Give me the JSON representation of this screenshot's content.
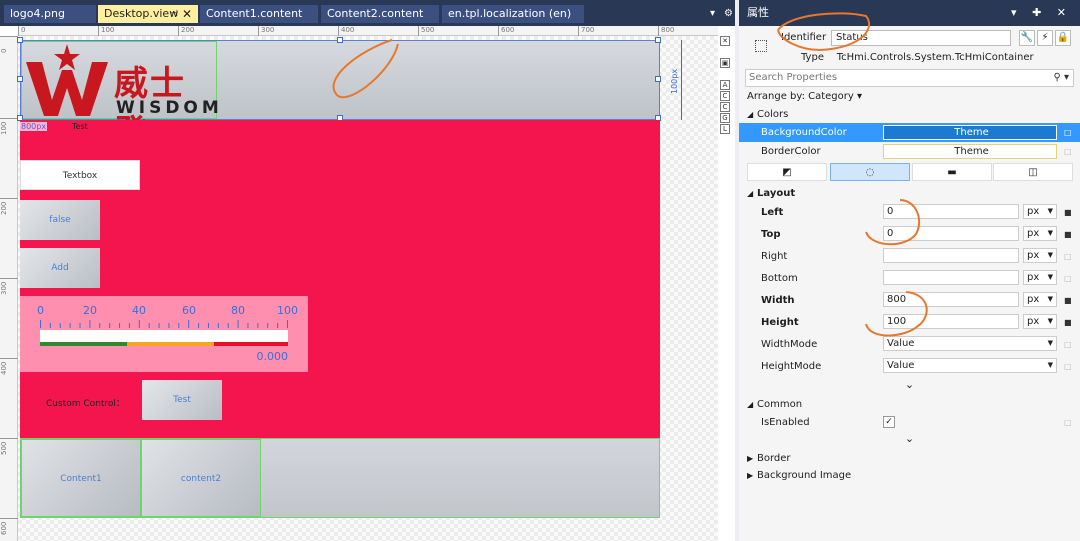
{
  "tabs": [
    {
      "label": "logo4.png"
    },
    {
      "label": "Desktop.view",
      "pin": "⊣",
      "close": "✕"
    },
    {
      "label": "Content1.content"
    },
    {
      "label": "Content2.content"
    },
    {
      "label": "en.tpl.localization (en)"
    }
  ],
  "tabstrip_controls": {
    "dropdown": "▾",
    "gear": "⚙"
  },
  "rulers": {
    "h": [
      "0",
      "100",
      "200",
      "300",
      "400",
      "500",
      "600",
      "700",
      "800"
    ],
    "v": [
      "0",
      "100",
      "200",
      "300",
      "400",
      "500",
      "600"
    ]
  },
  "designer": {
    "logo_cn": "威士登",
    "logo_en": "WISDOM",
    "height_dim": "100px",
    "width_dim": "800px",
    "test_label": "Test",
    "textbox": "Textbox",
    "false_button": "false",
    "add_button": "Add",
    "gauge_labels": [
      "0",
      "20",
      "40",
      "60",
      "80",
      "100"
    ],
    "gauge_value": "0.000",
    "custom_label": "Custom Control：",
    "custom_test": "Test",
    "content1": "Content1",
    "content2": "content2",
    "side_tools": [
      "A",
      "C",
      "C",
      "G",
      "L"
    ]
  },
  "props": {
    "title": "属性",
    "title_controls": "▾ ✚ ✕",
    "identifier_label": "Identifier",
    "identifier_value": "Status",
    "type_label": "Type",
    "type_value": "TcHmi.Controls.System.TcHmiContainer",
    "search_placeholder": "Search Properties",
    "arrange": "Arrange by: Category ▾",
    "colors_cat": "Colors",
    "colors": [
      {
        "name": "BackgroundColor",
        "value": "Theme"
      },
      {
        "name": "BorderColor",
        "value": "Theme"
      }
    ],
    "layout_cat": "Layout",
    "layout": [
      {
        "name": "Left",
        "value": "0",
        "unit": "px"
      },
      {
        "name": "Top",
        "value": "0",
        "unit": "px"
      },
      {
        "name": "Right",
        "value": "",
        "unit": "px"
      },
      {
        "name": "Bottom",
        "value": "",
        "unit": "px"
      },
      {
        "name": "Width",
        "value": "800",
        "unit": "px"
      },
      {
        "name": "Height",
        "value": "100",
        "unit": "px"
      },
      {
        "name": "WidthMode",
        "value": "Value"
      },
      {
        "name": "HeightMode",
        "value": "Value"
      }
    ],
    "common_cat": "Common",
    "is_enabled_label": "IsEnabled",
    "is_enabled_value": "✓",
    "border_cat": "Border",
    "background_image_cat": "Background Image"
  },
  "colors": {
    "accent": "#3399ff",
    "canvas_red": "#f5154e",
    "annotation": "#e8772e"
  }
}
